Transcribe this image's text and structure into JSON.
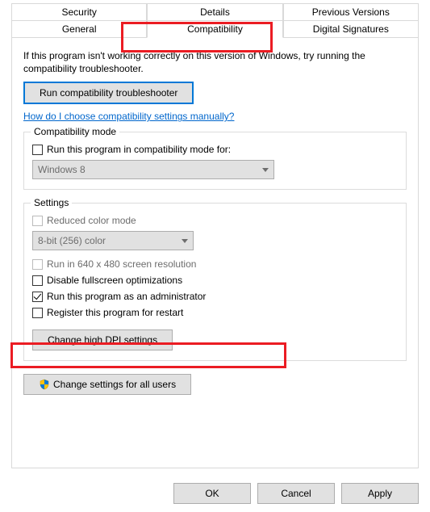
{
  "tabs": {
    "row1": {
      "security": "Security",
      "details": "Details",
      "previous": "Previous Versions"
    },
    "row2": {
      "general": "General",
      "compatibility": "Compatibility",
      "signatures": "Digital Signatures"
    }
  },
  "intro": "If this program isn't working correctly on this version of Windows, try running the compatibility troubleshooter.",
  "run_troubleshooter": "Run compatibility troubleshooter",
  "manual_link": "How do I choose compatibility settings manually?",
  "group_compat": {
    "title": "Compatibility mode",
    "checkbox_label": "Run this program in compatibility mode for:",
    "combo_value": "Windows 8"
  },
  "group_settings": {
    "title": "Settings",
    "reduced_color": "Reduced color mode",
    "color_combo": "8-bit (256) color",
    "run_640": "Run in 640 x 480 screen resolution",
    "disable_full": "Disable fullscreen optimizations",
    "run_admin": "Run this program as an administrator",
    "register_restart": "Register this program for restart",
    "dpi_button": "Change high DPI settings"
  },
  "all_users_button": "Change settings for all users",
  "footer": {
    "ok": "OK",
    "cancel": "Cancel",
    "apply": "Apply"
  }
}
